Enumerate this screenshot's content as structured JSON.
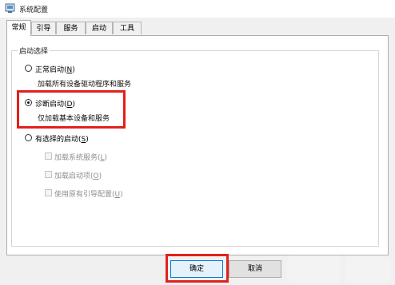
{
  "window": {
    "title": "系统配置"
  },
  "tabs": [
    {
      "label": "常规"
    },
    {
      "label": "引导"
    },
    {
      "label": "服务"
    },
    {
      "label": "启动"
    },
    {
      "label": "工具"
    }
  ],
  "startup_group": {
    "legend": "启动选择",
    "options": [
      {
        "label": "正常启动",
        "accel": "N",
        "description": "加载所有设备驱动程序和服务",
        "selected": false
      },
      {
        "label": "诊断启动",
        "accel": "D",
        "description": "仅加载基本设备和服务",
        "selected": true
      },
      {
        "label": "有选择的启动",
        "accel": "S",
        "selected": false
      }
    ],
    "sub_options": [
      {
        "label": "加载系统服务",
        "accel": "L",
        "checked": false,
        "enabled": false
      },
      {
        "label": "加载启动项",
        "accel": "O",
        "checked": false,
        "enabled": false
      },
      {
        "label": "使用原有引导配置",
        "accel": "U",
        "checked": false,
        "enabled": false
      }
    ]
  },
  "buttons": {
    "ok": "确定",
    "cancel": "取消"
  },
  "colors": {
    "highlight": "#e3201b",
    "accent": "#0078d7"
  }
}
